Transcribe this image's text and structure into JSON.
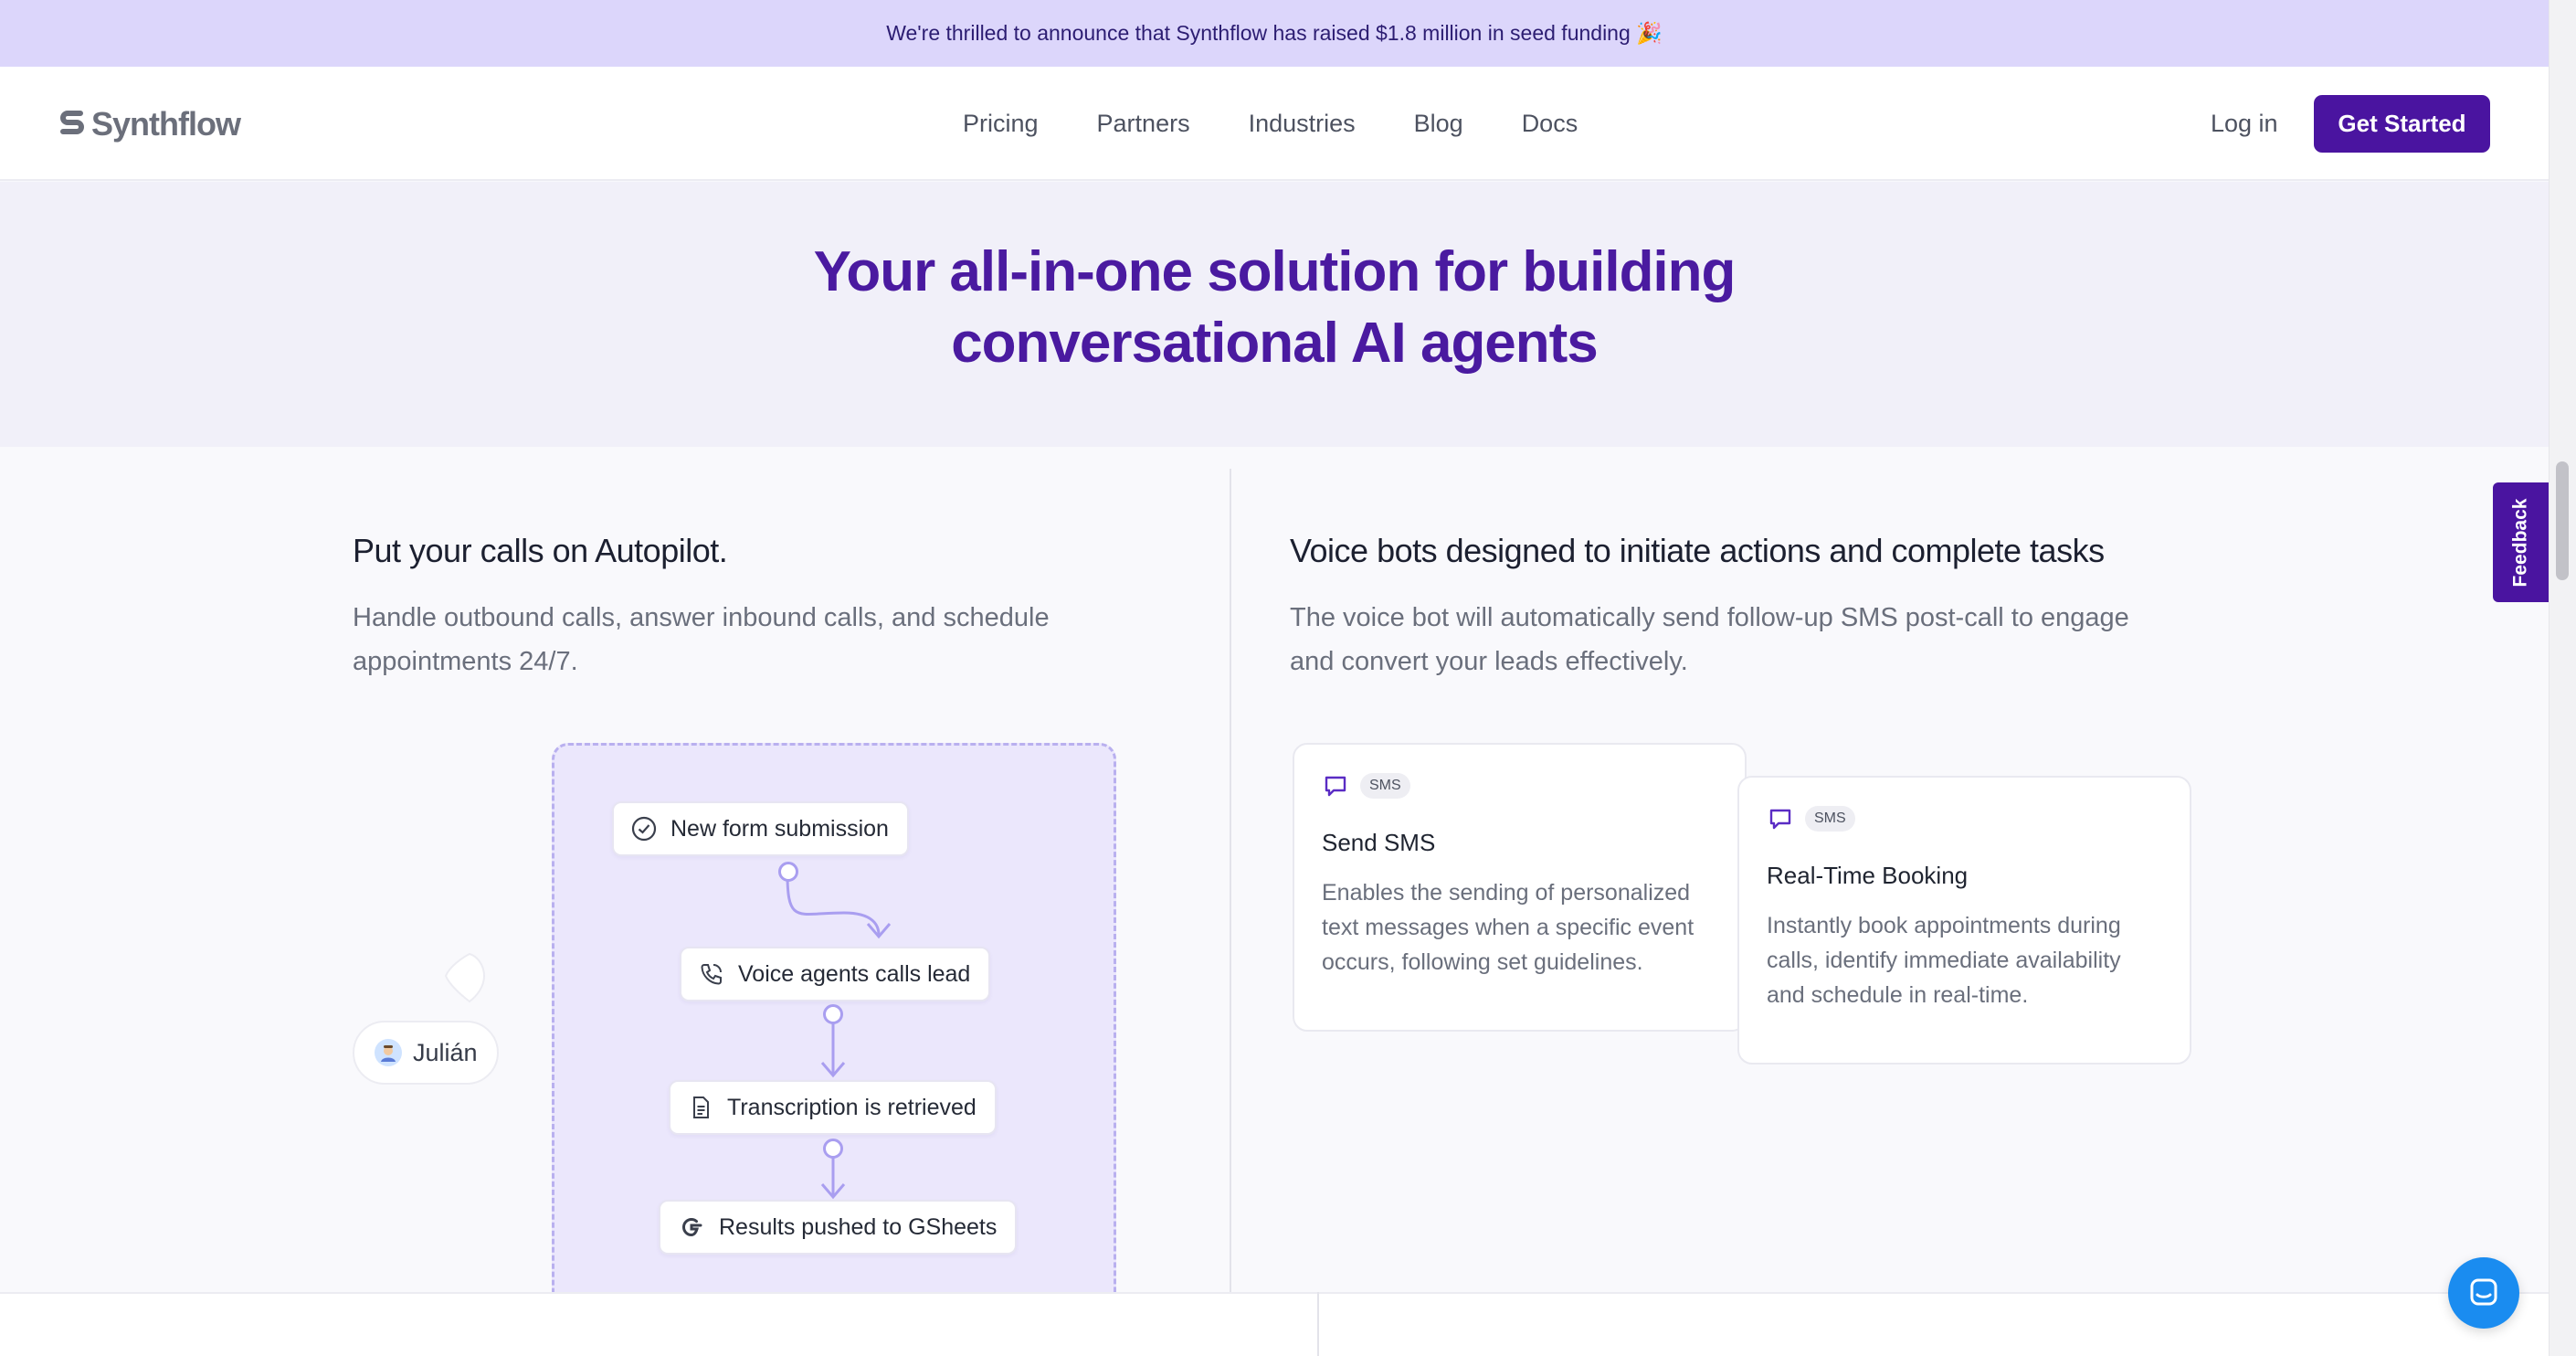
{
  "banner": {
    "text": "We're thrilled to announce that Synthflow has raised $1.8 million in seed funding 🎉"
  },
  "nav": {
    "logo": "Synthflow",
    "links": [
      "Pricing",
      "Partners",
      "Industries",
      "Blog",
      "Docs"
    ],
    "login": "Log in",
    "cta": "Get Started"
  },
  "hero": {
    "title_line1": "Your all-in-one solution for building",
    "title_line2": "conversational AI agents"
  },
  "left": {
    "title": "Put your calls on Autopilot.",
    "desc_line1": "Handle outbound calls, answer inbound calls, and schedule",
    "desc_line2": "appointments 24/7.",
    "workflow": [
      {
        "label": "New form submission",
        "icon": "check-circle-icon"
      },
      {
        "label": "Voice agents calls lead",
        "icon": "phone-icon"
      },
      {
        "label": "Transcription is retrieved",
        "icon": "document-icon"
      },
      {
        "label": "Results pushed to GSheets",
        "icon": "google-icon"
      }
    ],
    "user_chip": "Julián"
  },
  "right": {
    "title": "Voice bots designed to initiate actions and complete tasks",
    "desc_line1": "The voice bot will automatically send follow-up SMS post-call to engage",
    "desc_line2": "and convert your leads effectively.",
    "cards": [
      {
        "badge": "SMS",
        "title": "Send SMS",
        "desc_lines": [
          "Enables the sending of personalized",
          "text messages when a specific event",
          "occurs, following set guidelines."
        ]
      },
      {
        "badge": "SMS",
        "title": "Real-Time Booking",
        "desc_lines": [
          "Instantly book appointments during",
          "calls, identify immediate availability",
          "and schedule in real-time."
        ]
      }
    ]
  },
  "feedback": {
    "label": "Feedback"
  },
  "colors": {
    "brand": "#4a14a0",
    "banner": "#dcd6fb",
    "hero_title": "#4a1aa0",
    "chat": "#1a8cf0"
  }
}
